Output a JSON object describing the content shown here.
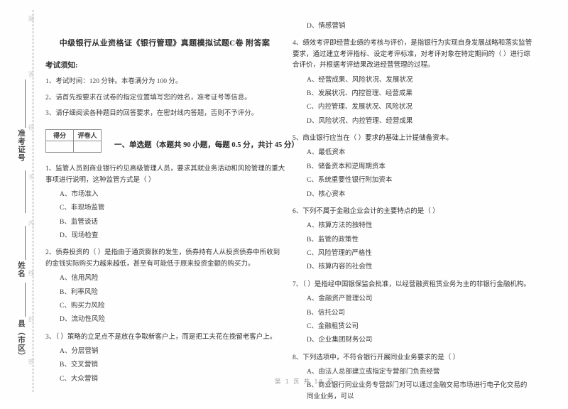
{
  "document": {
    "title": "中级银行从业资格证《银行管理》真题模拟试题C卷 附答案",
    "notice_heading": "考试须知:",
    "notices": [
      "1、考试时间：120 分钟。本卷满分为 100 分。",
      "2、请首先按要求在试卷的指定位置填写您的姓名，准考证号等信息。",
      "3、请仔细阅读各种题目的回答要求，在密封线内答题，否则不予评分。"
    ],
    "score_box": {
      "header_score": "得分",
      "header_grader": "评卷人",
      "value_score": "",
      "value_grader": ""
    },
    "section_title": "一、单选题（本题共 90 小题，每题 0.5 分，共计 45 分）",
    "footer": "第 1 页 共 18 页"
  },
  "left_margin": {
    "labels": [
      {
        "text": "准考证号"
      },
      {
        "text": "姓名"
      },
      {
        "text": "县（市区）"
      }
    ],
    "faint_marks": [
      "题",
      "答",
      "得",
      "不",
      "内",
      "线",
      "封",
      "密",
      "在",
      "须",
      "卷",
      "答"
    ]
  },
  "questions": [
    {
      "number": "1",
      "stem": "1、监管人员到商业银行约见高级管理人员，要求其就业务活动和风险管理的重大事项进行说明，这种监管方式是（    ）",
      "options": [
        "A、市场准入",
        "C、非现场监管",
        "B、监管谈话",
        "D、现场检查"
      ]
    },
    {
      "number": "2",
      "stem": "2、债券投资的（      ）是指由于通货膨胀的发生，债券持有人从投资债券中所收到的金钱实际购买力越来越低，甚至有可能低于原来投资金额的购买力。",
      "options": [
        "A、信用风险",
        "B、利率风险",
        "C、购买力风险",
        "D、流动性风险"
      ]
    },
    {
      "number": "3",
      "stem": "3、（      ）策略的立足点不是放在争取新客户上，而是把工夫花在挽留老客户上。",
      "options": [
        "A、分层营销",
        "B、交叉营销",
        "C、大众营销"
      ]
    },
    {
      "number": "3b",
      "stem": "",
      "options": [
        "D、情感营销"
      ]
    },
    {
      "number": "4",
      "stem": "4、绩效考评即经营业绩的考核与评价，是指银行为实现自身发展战略和落实监管要求，通过建立考评指标、设定考评标准，对考评对象在特定期间的（      ）进行综合评价，并根据考评结果改进经营管理的过程。",
      "options": [
        "A、经营成果、风险状况、发展状况",
        "B、发展状况、内控管理、经营成果",
        "C、内控管理、发展状况、风险状况",
        "D、风险状况、内控管理、经营成果"
      ]
    },
    {
      "number": "5",
      "stem": "5、商业银行应当在（      ）要求的基础上计提储备资本。",
      "options": [
        "A、最低资本",
        "B、储备资本和逆周期资本",
        "C、系统重要性银行附加资本",
        "D、核心资本"
      ]
    },
    {
      "number": "6",
      "stem": "6、下列不属于金融企业会计的主要特点的是（      ）",
      "options": [
        "A、核算方法的独特性",
        "B、监管的政策性",
        "C、风险管理的严格性",
        "D、核算内容的社会性"
      ]
    },
    {
      "number": "7",
      "stem": "7、（      ）是指经中国银保监会批准，以经营融资租赁业务为主的非银行金融机构。",
      "options": [
        "A、金融资产管理公司",
        "B、信托公司",
        "C、金融租赁公司",
        "D、企业集团财务公司"
      ]
    },
    {
      "number": "8",
      "stem": "8、下列选项中，不符合银行开展同业业务要求的是（      ）",
      "options": [
        "A、由法人总部建立或指定专营部门负责经营",
        "B、商业银行同业业务专营部门对可以通过金融交易市场进行电子化交易的同业业务，可以"
      ]
    }
  ]
}
